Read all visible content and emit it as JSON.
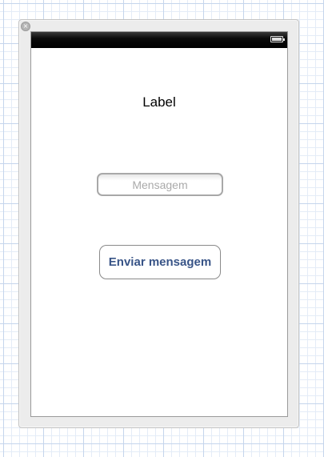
{
  "window": {
    "close_glyph": "×"
  },
  "status_bar": {
    "battery_icon": "battery-icon"
  },
  "main": {
    "label_text": "Label",
    "message_field": {
      "placeholder": "Mensagem",
      "value": ""
    },
    "send_button_label": "Enviar mensagem"
  },
  "colors": {
    "status_bar": "#000000",
    "button_text": "#385487",
    "placeholder": "#aaaaaa"
  }
}
